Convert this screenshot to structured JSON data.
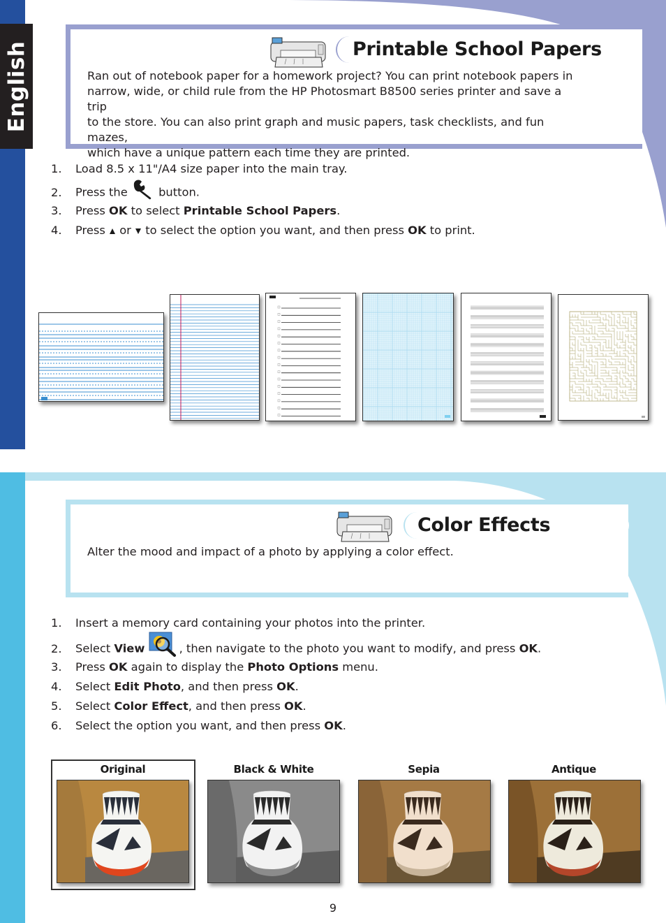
{
  "language_tab": "English",
  "colors": {
    "side_bar_top": "#24509e",
    "side_bar_bottom": "#4fbde3",
    "section1_accent": "#99a0cf",
    "section2_accent": "#b8e2f0",
    "language_tab_bg": "#231f20"
  },
  "section1": {
    "icon": "printer-icon",
    "title": "Printable School Papers",
    "intro_lines": [
      "Ran out of notebook paper for a homework project? You can print notebook papers in",
      "narrow, wide, or child rule from the HP Photosmart B8500 series printer and save a trip",
      "to the store. You can also print graph and music papers, task checklists, and fun mazes,",
      "which have a unique pattern each time they are printed."
    ],
    "steps": [
      {
        "num": "1.",
        "parts": [
          {
            "t": "Load 8.5 x 11\"/A4 size paper into the main tray."
          }
        ]
      },
      {
        "num": "2.",
        "parts": [
          {
            "t": "Press the "
          },
          {
            "icon": "wrench-icon"
          },
          {
            "t": " button."
          }
        ]
      },
      {
        "num": "3.",
        "parts": [
          {
            "t": "Press "
          },
          {
            "b": "OK"
          },
          {
            "t": " to select "
          },
          {
            "b": "Printable School Papers"
          },
          {
            "t": "."
          }
        ]
      },
      {
        "num": "4.",
        "parts": [
          {
            "t": "Press "
          },
          {
            "icon": "up-arrow-icon"
          },
          {
            "t": " or "
          },
          {
            "icon": "down-arrow-icon"
          },
          {
            "t": " to select the option you want, and then press "
          },
          {
            "b": "OK"
          },
          {
            "t": " to print."
          }
        ]
      }
    ],
    "paper_samples": [
      {
        "name": "child-rule-paper"
      },
      {
        "name": "wide-rule-paper"
      },
      {
        "name": "task-checklist-paper"
      },
      {
        "name": "graph-paper"
      },
      {
        "name": "music-paper"
      },
      {
        "name": "maze-paper"
      }
    ]
  },
  "section2": {
    "icon": "printer-icon",
    "title": "Color Effects",
    "intro": "Alter the mood and impact of a photo by applying a color effect.",
    "steps": [
      {
        "num": "1.",
        "parts": [
          {
            "t": "Insert a memory card containing your photos into the printer."
          }
        ]
      },
      {
        "num": "2.",
        "parts": [
          {
            "t": "Select "
          },
          {
            "b": "View"
          },
          {
            "t": " "
          },
          {
            "icon": "view-photo-icon"
          },
          {
            "t": ", then navigate to the photo you want to modify, and press "
          },
          {
            "b": "OK"
          },
          {
            "t": "."
          }
        ]
      },
      {
        "num": "3.",
        "parts": [
          {
            "t": "Press "
          },
          {
            "b": "OK"
          },
          {
            "t": " again to display the "
          },
          {
            "b": "Photo Options"
          },
          {
            "t": " menu."
          }
        ]
      },
      {
        "num": "4.",
        "parts": [
          {
            "t": "Select "
          },
          {
            "b": "Edit Photo"
          },
          {
            "t": ", and then press "
          },
          {
            "b": "OK"
          },
          {
            "t": "."
          }
        ]
      },
      {
        "num": "5.",
        "parts": [
          {
            "t": "Select "
          },
          {
            "b": "Color Effect"
          },
          {
            "t": ", and then press "
          },
          {
            "b": "OK"
          },
          {
            "t": "."
          }
        ]
      },
      {
        "num": "6.",
        "parts": [
          {
            "t": "Select the option you want, and then press "
          },
          {
            "b": "OK"
          },
          {
            "t": "."
          }
        ]
      }
    ],
    "photos": [
      {
        "label": "Original",
        "effect": "original"
      },
      {
        "label": "Black & White",
        "effect": "bw"
      },
      {
        "label": "Sepia",
        "effect": "sepia"
      },
      {
        "label": "Antique",
        "effect": "antique"
      }
    ]
  },
  "page_number": "9"
}
